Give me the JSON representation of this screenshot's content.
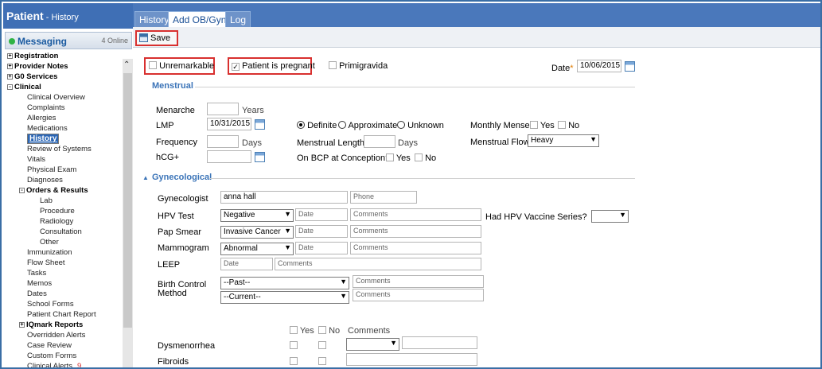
{
  "sidebar": {
    "title": "Patient",
    "subtitle": "History",
    "messaging": "Messaging",
    "online": "4 Online",
    "items": [
      "Registration",
      "Provider Notes",
      "G0 Services",
      "Clinical",
      "Clinical Overview",
      "Complaints",
      "Allergies",
      "Medications",
      "History",
      "Review of Systems",
      "Vitals",
      "Physical Exam",
      "Diagnoses",
      "Orders & Results",
      "Lab",
      "Procedure",
      "Radiology",
      "Consultation",
      "Other",
      "Immunization",
      "Flow Sheet",
      "Tasks",
      "Memos",
      "Dates",
      "School Forms",
      "Patient Chart Report",
      "IQmark Reports",
      "Overridden Alerts",
      "Case Review",
      "Custom Forms",
      "Clinical Alerts"
    ],
    "alert_count": "9"
  },
  "tabs": [
    "History",
    "Add OB/Gyn",
    "Log"
  ],
  "toolbar": {
    "save": "Save"
  },
  "top": {
    "unremarkable": "Unremarkable",
    "pregnant": "Patient is pregnant",
    "primigravida": "Primigravida",
    "date_label": "Date",
    "date_value": "10/06/2015"
  },
  "menstrual": {
    "title": "Menstrual",
    "menarche": "Menarche",
    "years": "Years",
    "lmp": "LMP",
    "lmp_value": "10/31/2015",
    "definite": "Definite",
    "approximate": "Approximate",
    "unknown": "Unknown",
    "monthly_menses": "Monthly Menses",
    "yes": "Yes",
    "no": "No",
    "frequency": "Frequency",
    "days": "Days",
    "menstrual_length": "Menstrual Length",
    "menstrual_flow": "Menstrual Flow",
    "flow_value": "Heavy",
    "hcg": "hCG+",
    "bcp": "On BCP at Conception?"
  },
  "gyn": {
    "title": "Gynecological",
    "gynecologist": "Gynecologist",
    "gyn_value": "anna hall",
    "phone": "Phone",
    "hpv": "HPV Test",
    "hpv_value": "Negative",
    "date_ph": "Date",
    "comments_ph": "Comments",
    "hpv_vaccine": "Had HPV Vaccine Series?",
    "pap": "Pap Smear",
    "pap_value": "Invasive Cancer",
    "mammo": "Mammogram",
    "mammo_value": "Abnormal",
    "leep": "LEEP",
    "bc_label1": "Birth Control",
    "bc_label2": "Method",
    "bc_past": "--Past--",
    "bc_current": "--Current--",
    "col_comments": "Comments",
    "dysmenorrhea": "Dysmenorrhea",
    "fibroids": "Fibroids"
  }
}
